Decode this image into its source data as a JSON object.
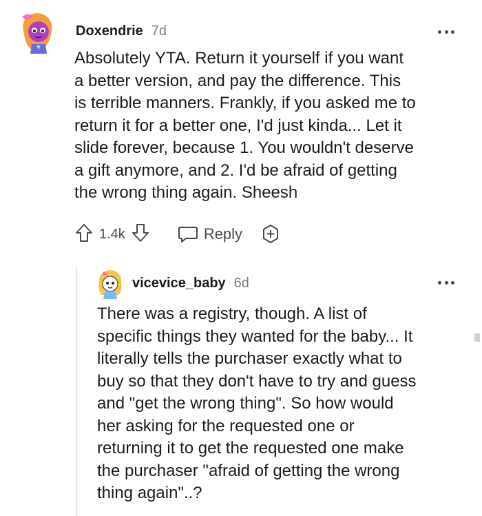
{
  "comment": {
    "author": "Doxendrie",
    "age": "7d",
    "body": "Absolutely YTA. Return it yourself if you want\na better version, and pay the difference. This\nis terrible manners. Frankly, if you asked me to\nreturn it for a better one, I'd just kinda... Let it\nslide forever, because 1. You wouldn't deserve\na gift anymore, and 2. I'd be afraid of getting\nthe wrong thing again. Sheesh",
    "score": "1.4k",
    "reply_label": "Reply",
    "avatar_icon": "snoo-avatar-purple-icon"
  },
  "reply": {
    "author": "vicevice_baby",
    "age": "6d",
    "body": "There was a registry, though. A list of\nspecific things they wanted for the baby... It\nliterally tells the purchaser exactly what to\nbuy so that they don't have to try and guess\nand \"get the wrong thing\". So how would\nher asking for the requested one or\nreturning it to get the requested one make\nthe purchaser \"afraid of getting the wrong\nthing again\"..?",
    "avatar_icon": "snoo-avatar-yellow-icon"
  },
  "colors": {
    "text": "#1c1c1c",
    "meta": "#7c7c7c",
    "icon": "#4a4a4a",
    "thread_line": "#e6e6e6"
  }
}
